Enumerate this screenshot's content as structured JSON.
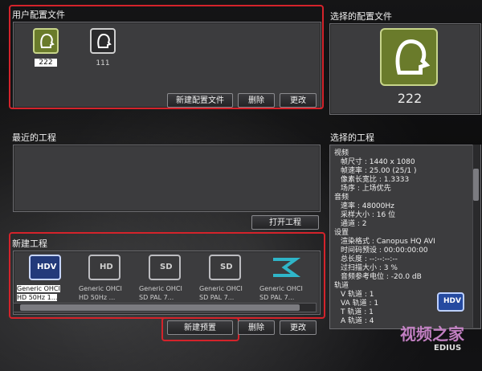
{
  "user_profiles": {
    "title": "用户配置文件",
    "items": [
      {
        "label": "222",
        "selected": true,
        "icon": "user-head-icon"
      },
      {
        "label": "111",
        "selected": false,
        "icon": "user-head-icon"
      }
    ],
    "buttons": {
      "new": "新建配置文件",
      "delete": "删除",
      "change": "更改"
    }
  },
  "selected_profile": {
    "title": "选择的配置文件",
    "name": "222",
    "icon": "user-head-icon"
  },
  "recent_projects": {
    "title": "最近的工程",
    "open_button": "打开工程"
  },
  "selected_project": {
    "title": "选择的工程",
    "lines": [
      "视频",
      "帧尺寸 : 1440 x 1080",
      "帧速率 : 25.00 (25/1 )",
      "像素长宽比 : 1.3333",
      "场序 : 上场优先",
      "音频",
      "速率 : 48000Hz",
      "采样大小 : 16 位",
      "通道 : 2",
      "设置",
      "渲染格式 : Canopus HQ AVI",
      "时间码预设 : 00:00:00:00",
      "总长度 : --:--:--:--",
      "过扫描大小 : 3 %",
      "音频参考电位 : -20.0 dB",
      "轨道",
      "V 轨道 : 1",
      "VA 轨道 : 1",
      "T 轨道 : 1",
      "A 轨道 : 4"
    ],
    "badge_icon": "hdv-icon"
  },
  "new_project": {
    "title": "新建工程",
    "presets": [
      {
        "icon": "hdv-icon",
        "icon_text": "HDV",
        "line1": "Generic OHCI",
        "line2": "HD 50Hz  1...",
        "selected": true
      },
      {
        "icon": "hd-icon",
        "icon_text": "HD",
        "line1": "Generic OHCI",
        "line2": "HD 50Hz  ...",
        "selected": false
      },
      {
        "icon": "sd-icon",
        "icon_text": "SD",
        "line1": "Generic OHCI",
        "line2": "SD PAL  7...",
        "selected": false
      },
      {
        "icon": "sd-icon",
        "icon_text": "SD",
        "line1": "Generic OHCI",
        "line2": "SD PAL  7...",
        "selected": false
      },
      {
        "icon": "edius-icon",
        "icon_text": "",
        "line1": "Generic OHCI",
        "line2": "SD PAL  7...",
        "selected": false
      }
    ],
    "buttons": {
      "new_preset": "新建预置",
      "delete": "删除",
      "change": "更改"
    }
  },
  "watermark": {
    "main": "视频之家",
    "sub": "EDIUS"
  },
  "colors": {
    "accent_red": "#d4232b",
    "profile_green": "#6a7b2b"
  }
}
